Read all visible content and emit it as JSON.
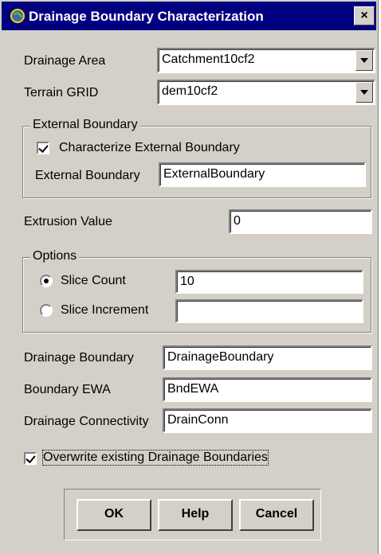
{
  "title": "Drainage Boundary Characterization",
  "close_label": "×",
  "drainage_area": {
    "label": "Drainage Area",
    "value": "Catchment10cf2"
  },
  "terrain_grid": {
    "label": "Terrain GRID",
    "value": "dem10cf2"
  },
  "external_boundary_group": {
    "label": "External Boundary",
    "characterize_label": "Characterize External Boundary",
    "characterize_checked": true,
    "field_label": "External Boundary",
    "field_value": "ExternalBoundary"
  },
  "extrusion": {
    "label": "Extrusion Value",
    "value": "0"
  },
  "options_group": {
    "label": "Options",
    "slice_count_label": "Slice Count",
    "slice_count_value": "10",
    "slice_increment_label": "Slice Increment",
    "slice_increment_value": "",
    "selected": "Slice Count"
  },
  "drainage_boundary": {
    "label": "Drainage Boundary",
    "value": "DrainageBoundary"
  },
  "boundary_ewa": {
    "label": "Boundary EWA",
    "value": "BndEWA"
  },
  "drainage_connectivity": {
    "label": "Drainage Connectivity",
    "value": "DrainConn"
  },
  "overwrite": {
    "label": "Overwrite existing Drainage Boundaries",
    "checked": true
  },
  "buttons": {
    "ok": "OK",
    "help": "Help",
    "cancel": "Cancel"
  }
}
